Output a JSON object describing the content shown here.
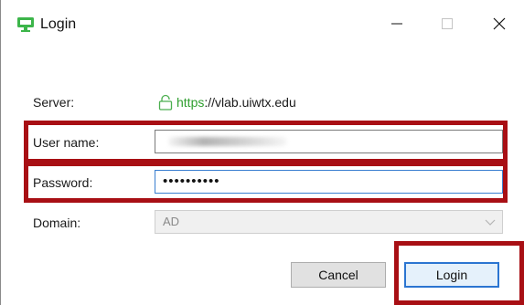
{
  "window": {
    "title": "Login",
    "app_icon": "monitor-icon",
    "controls": {
      "minimize_icon": "minimize-icon",
      "maximize_icon": "maximize-icon",
      "close_icon": "close-icon"
    }
  },
  "form": {
    "server_label": "Server:",
    "server_url_scheme": "https",
    "server_url_rest": "://vlab.uiwtx.edu",
    "server_icon": "lock-icon",
    "username_label": "User name:",
    "username_value": "",
    "password_label": "Password:",
    "password_value": "••••••••••",
    "domain_label": "Domain:",
    "domain_value": "AD"
  },
  "buttons": {
    "cancel_label": "Cancel",
    "login_label": "Login"
  },
  "colors": {
    "https_green": "#2e9e2e",
    "annotation_red": "#a80f14",
    "focus_blue": "#2b75d1"
  }
}
